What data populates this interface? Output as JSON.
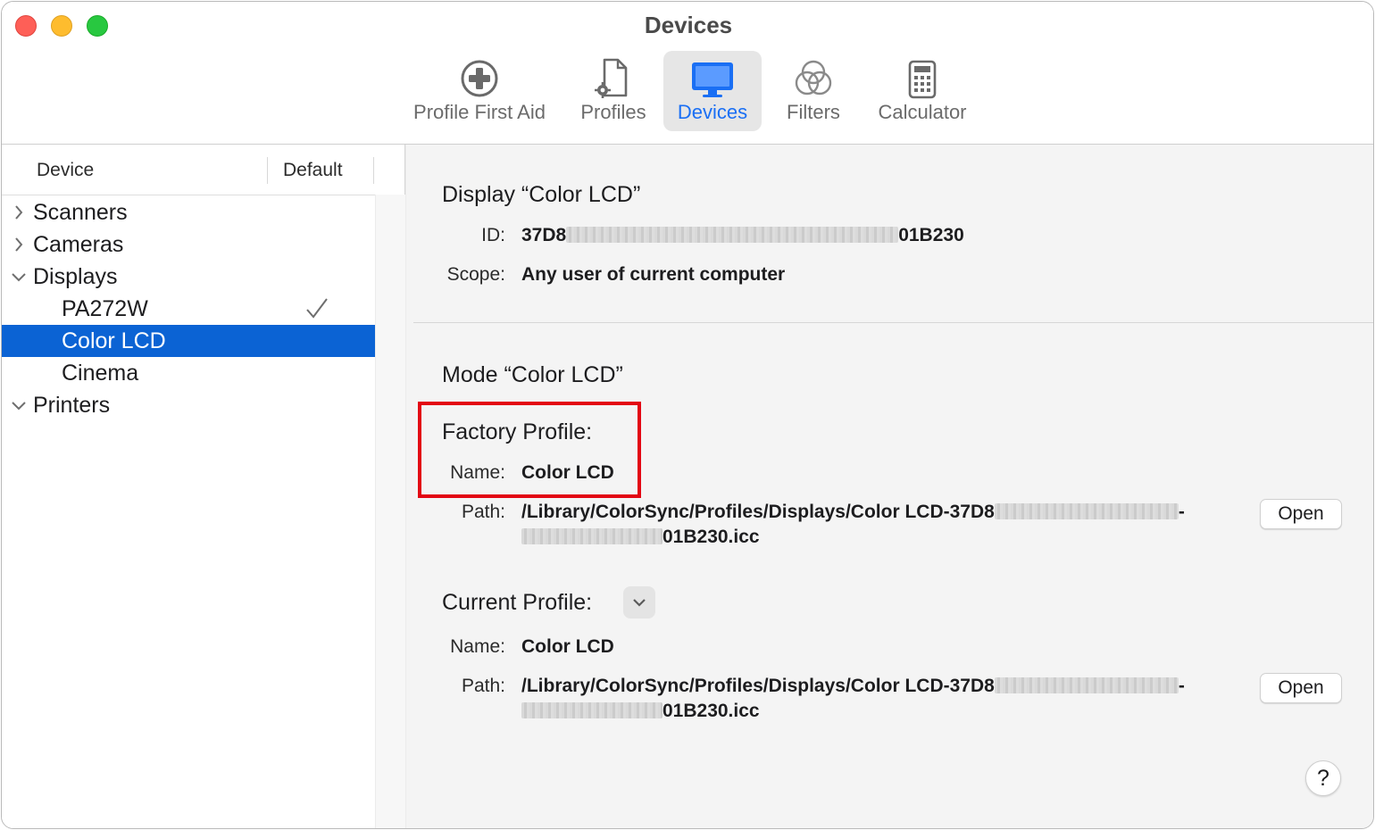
{
  "window": {
    "title": "Devices"
  },
  "toolbar": {
    "items": [
      {
        "label": "Profile First Aid",
        "icon": "first-aid-icon",
        "active": false
      },
      {
        "label": "Profiles",
        "icon": "profile-document-icon",
        "active": false
      },
      {
        "label": "Devices",
        "icon": "display-icon",
        "active": true
      },
      {
        "label": "Filters",
        "icon": "filters-icon",
        "active": false
      },
      {
        "label": "Calculator",
        "icon": "calculator-icon",
        "active": false
      }
    ]
  },
  "sidebar": {
    "columns": {
      "device": "Device",
      "default": "Default"
    },
    "items": [
      {
        "label": "Scanners",
        "type": "group",
        "expanded": false
      },
      {
        "label": "Cameras",
        "type": "group",
        "expanded": false
      },
      {
        "label": "Displays",
        "type": "group",
        "expanded": true
      },
      {
        "label": "PA272W",
        "type": "child",
        "default": true
      },
      {
        "label": "Color LCD",
        "type": "child",
        "selected": true
      },
      {
        "label": "Cinema",
        "type": "child"
      },
      {
        "label": "Printers",
        "type": "group",
        "expanded": true
      }
    ]
  },
  "detail": {
    "display_heading": "Display “Color LCD”",
    "id_label": "ID:",
    "id_prefix": "37D8",
    "id_suffix": "01B230",
    "scope_label": "Scope:",
    "scope_value": "Any user of current computer",
    "mode_heading": "Mode “Color LCD”",
    "factory": {
      "heading": "Factory Profile:",
      "name_label": "Name:",
      "name_value": "Color LCD",
      "path_label": "Path:",
      "path_line1": "/Library/ColorSync/Profiles/Displays/Color LCD-37D8",
      "path_dash": "-",
      "path_line2": "01B230.icc",
      "open_label": "Open"
    },
    "current": {
      "heading": "Current Profile:",
      "name_label": "Name:",
      "name_value": "Color LCD",
      "path_label": "Path:",
      "path_line1": "/Library/ColorSync/Profiles/Displays/Color LCD-37D8",
      "path_dash": "-",
      "path_line2": "01B230.icc",
      "open_label": "Open"
    },
    "help_label": "?"
  },
  "colors": {
    "accent": "#0b63d4",
    "active_tab_text": "#1a6ff4",
    "highlight_border": "#e30613"
  }
}
